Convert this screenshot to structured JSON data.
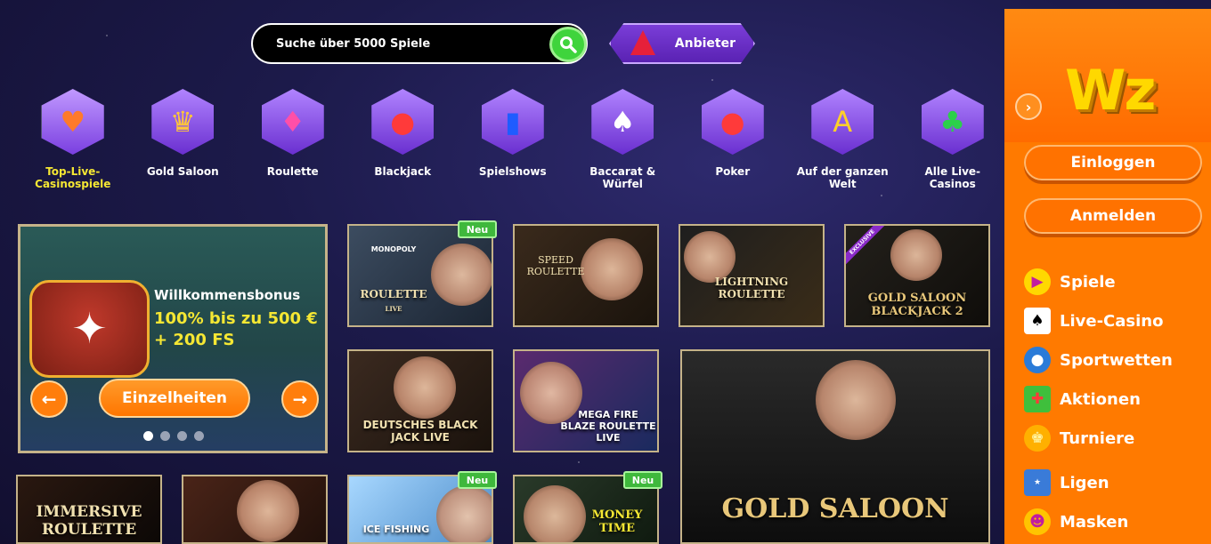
{
  "search": {
    "placeholder": "Suche über 5000 Spiele"
  },
  "provider": {
    "label": "Anbieter"
  },
  "categories": [
    {
      "label": "Top-Live-Casinospiele",
      "icon": "heart-icon",
      "active": true
    },
    {
      "label": "Gold Saloon",
      "icon": "crown-icon"
    },
    {
      "label": "Roulette",
      "icon": "diamond-icon"
    },
    {
      "label": "Blackjack",
      "icon": "chips-icon"
    },
    {
      "label": "Spielshows",
      "icon": "top-hat-icon"
    },
    {
      "label": "Baccarat & Würfel",
      "icon": "spade-card-icon"
    },
    {
      "label": "Poker",
      "icon": "poker-chips-icon"
    },
    {
      "label": "Auf der ganzen Welt",
      "icon": "globe-letters-icon"
    },
    {
      "label": "Alle Live-Casinos",
      "icon": "club-icon"
    }
  ],
  "bonus": {
    "title": "Willkommensbonus",
    "subtitle": "100% bis zu 500 € + 200 FS",
    "details_label": "Einzelheiten"
  },
  "games": [
    {
      "name": "ROULETTE",
      "badge": "Neu",
      "logo_lines": [
        "MONOPOLY",
        "ROULETTE",
        "LIVE"
      ]
    },
    {
      "name": "SPEED ROULETTE"
    },
    {
      "name": "LIGHTNING ROULETTE"
    },
    {
      "name": "GOLD SALOON BLACKJACK 2",
      "ribbon": "EXCLUSIVE"
    },
    {
      "name": "DEUTSCHES BLACK JACK LIVE"
    },
    {
      "name": "MEGA FIRE BLAZE ROULETTE LIVE"
    },
    {
      "name": "GOLD SALOON"
    },
    {
      "name": "IMMERSIVE ROULETTE"
    },
    {
      "name": ""
    },
    {
      "name": "ICE FISHING",
      "badge": "Neu"
    },
    {
      "name": "MONEY TIME",
      "badge": "Neu"
    }
  ],
  "sidebar": {
    "logo": "Wz",
    "login": "Einloggen",
    "register": "Anmelden",
    "items": [
      {
        "label": "Spiele",
        "icon": "play-icon"
      },
      {
        "label": "Live-Casino",
        "icon": "cards-icon"
      },
      {
        "label": "Sportwetten",
        "icon": "football-icon"
      },
      {
        "label": "Aktionen",
        "icon": "gift-icon"
      },
      {
        "label": "Turniere",
        "icon": "trophy-icon"
      },
      {
        "label": "Ligen",
        "icon": "league-new-icon"
      },
      {
        "label": "Masken",
        "icon": "mask-icon"
      }
    ]
  }
}
